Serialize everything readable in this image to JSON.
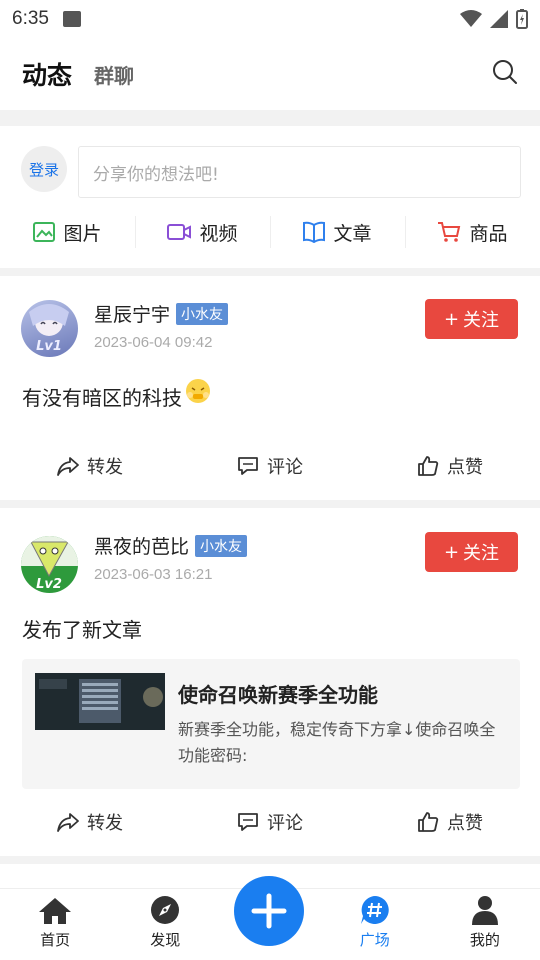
{
  "status_bar": {
    "time": "6:35"
  },
  "header": {
    "active_tab": "动态",
    "tab2": "群聊"
  },
  "compose": {
    "login_label": "登录",
    "placeholder": "分享你的想法吧!",
    "types": [
      {
        "label": "图片",
        "icon": "image-icon",
        "color": "#3cb55a"
      },
      {
        "label": "视频",
        "icon": "video-icon",
        "color": "#8a4fd6"
      },
      {
        "label": "文章",
        "icon": "book-icon",
        "color": "#2f80ed"
      },
      {
        "label": "商品",
        "icon": "cart-icon",
        "color": "#e8483f"
      }
    ]
  },
  "posts": [
    {
      "username": "星辰宁宇",
      "badge": "小水友",
      "time": "2023-06-04 09:42",
      "level": "Lv1",
      "follow_label": "关注",
      "content": "有没有暗区的科技",
      "actions": {
        "share": "转发",
        "comment": "评论",
        "like": "点赞"
      }
    },
    {
      "username": "黑夜的芭比",
      "badge": "小水友",
      "time": "2023-06-03 16:21",
      "level": "Lv2",
      "follow_label": "关注",
      "content": "发布了新文章",
      "article": {
        "title": "使命召唤新赛季全功能",
        "desc": "新赛季全功能，稳定传奇下方拿↓使命召唤全功能密码:"
      },
      "actions": {
        "share": "转发",
        "comment": "评论",
        "like": "点赞"
      }
    }
  ],
  "tabbar": {
    "items": [
      {
        "label": "首页",
        "icon": "home-icon"
      },
      {
        "label": "发现",
        "icon": "compass-icon"
      },
      {
        "label": "广场",
        "icon": "hashtag-icon",
        "active": true
      },
      {
        "label": "我的",
        "icon": "profile-icon"
      }
    ]
  },
  "colors": {
    "accent": "#1a7ef0",
    "follow": "#e8483f",
    "badge": "#5b8ed6"
  }
}
